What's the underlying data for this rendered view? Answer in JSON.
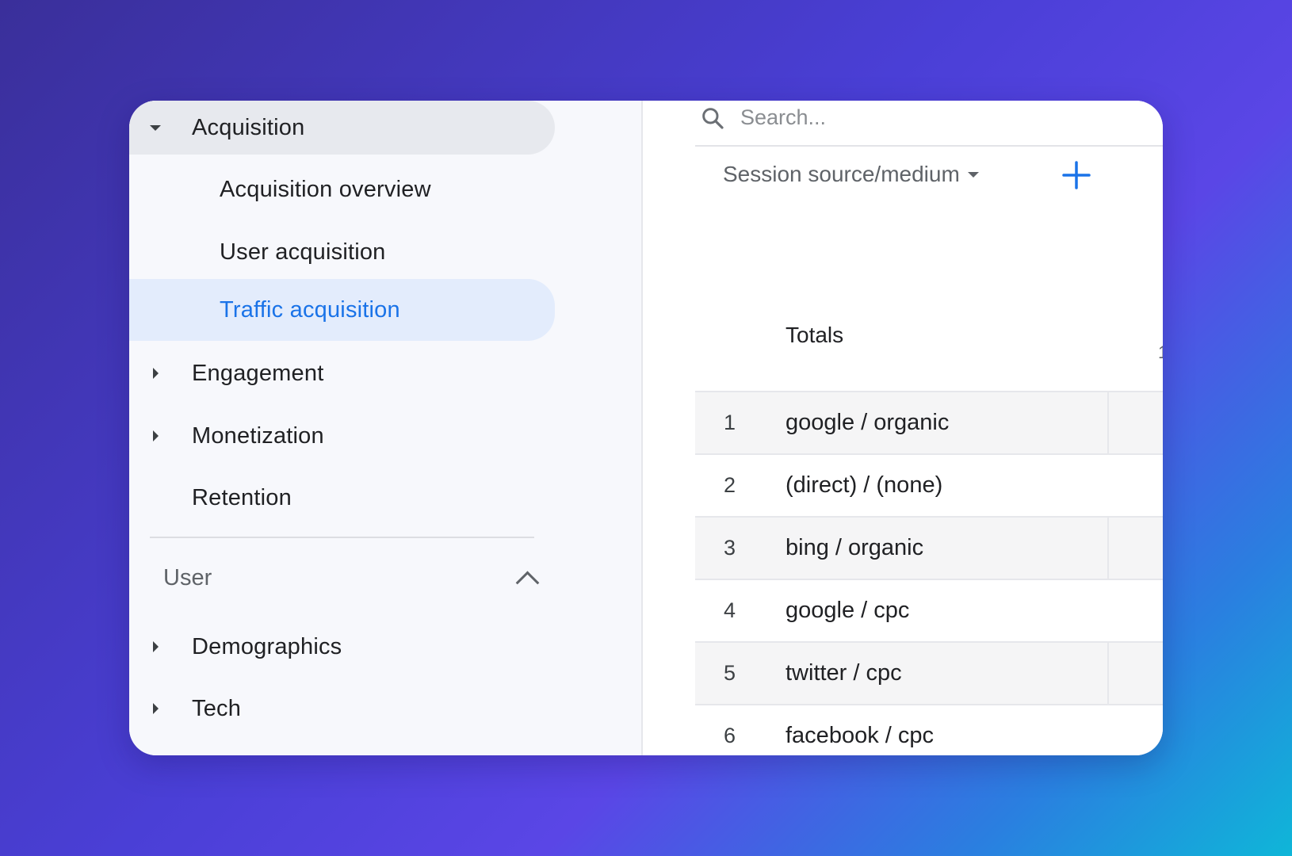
{
  "sidebar": {
    "items": [
      {
        "label": "Acquisition",
        "caret": "down"
      },
      {
        "label": "Acquisition overview"
      },
      {
        "label": "User acquisition"
      },
      {
        "label": "Traffic acquisition",
        "active": true
      },
      {
        "label": "Engagement",
        "caret": "right"
      },
      {
        "label": "Monetization",
        "caret": "right"
      },
      {
        "label": "Retention"
      }
    ],
    "user_section": {
      "title": "User",
      "items": [
        {
          "label": "Demographics",
          "caret": "right"
        },
        {
          "label": "Tech",
          "caret": "right"
        }
      ]
    }
  },
  "main": {
    "search": {
      "placeholder": "Search...",
      "icon": "search-icon"
    },
    "dimension_label": "Session source/medium",
    "add_icon": "plus-icon",
    "totals_label": "Totals",
    "totals_partial": "1",
    "rows": [
      {
        "index": "1",
        "source": "google / organic"
      },
      {
        "index": "2",
        "source": "(direct) / (none)"
      },
      {
        "index": "3",
        "source": "bing / organic"
      },
      {
        "index": "4",
        "source": "google / cpc"
      },
      {
        "index": "5",
        "source": "twitter / cpc"
      },
      {
        "index": "6",
        "source": "facebook / cpc"
      }
    ]
  },
  "colors": {
    "accent": "#1a73e8",
    "active_bg": "#e3ecfc",
    "selected_parent_bg": "#e7e9ee"
  }
}
